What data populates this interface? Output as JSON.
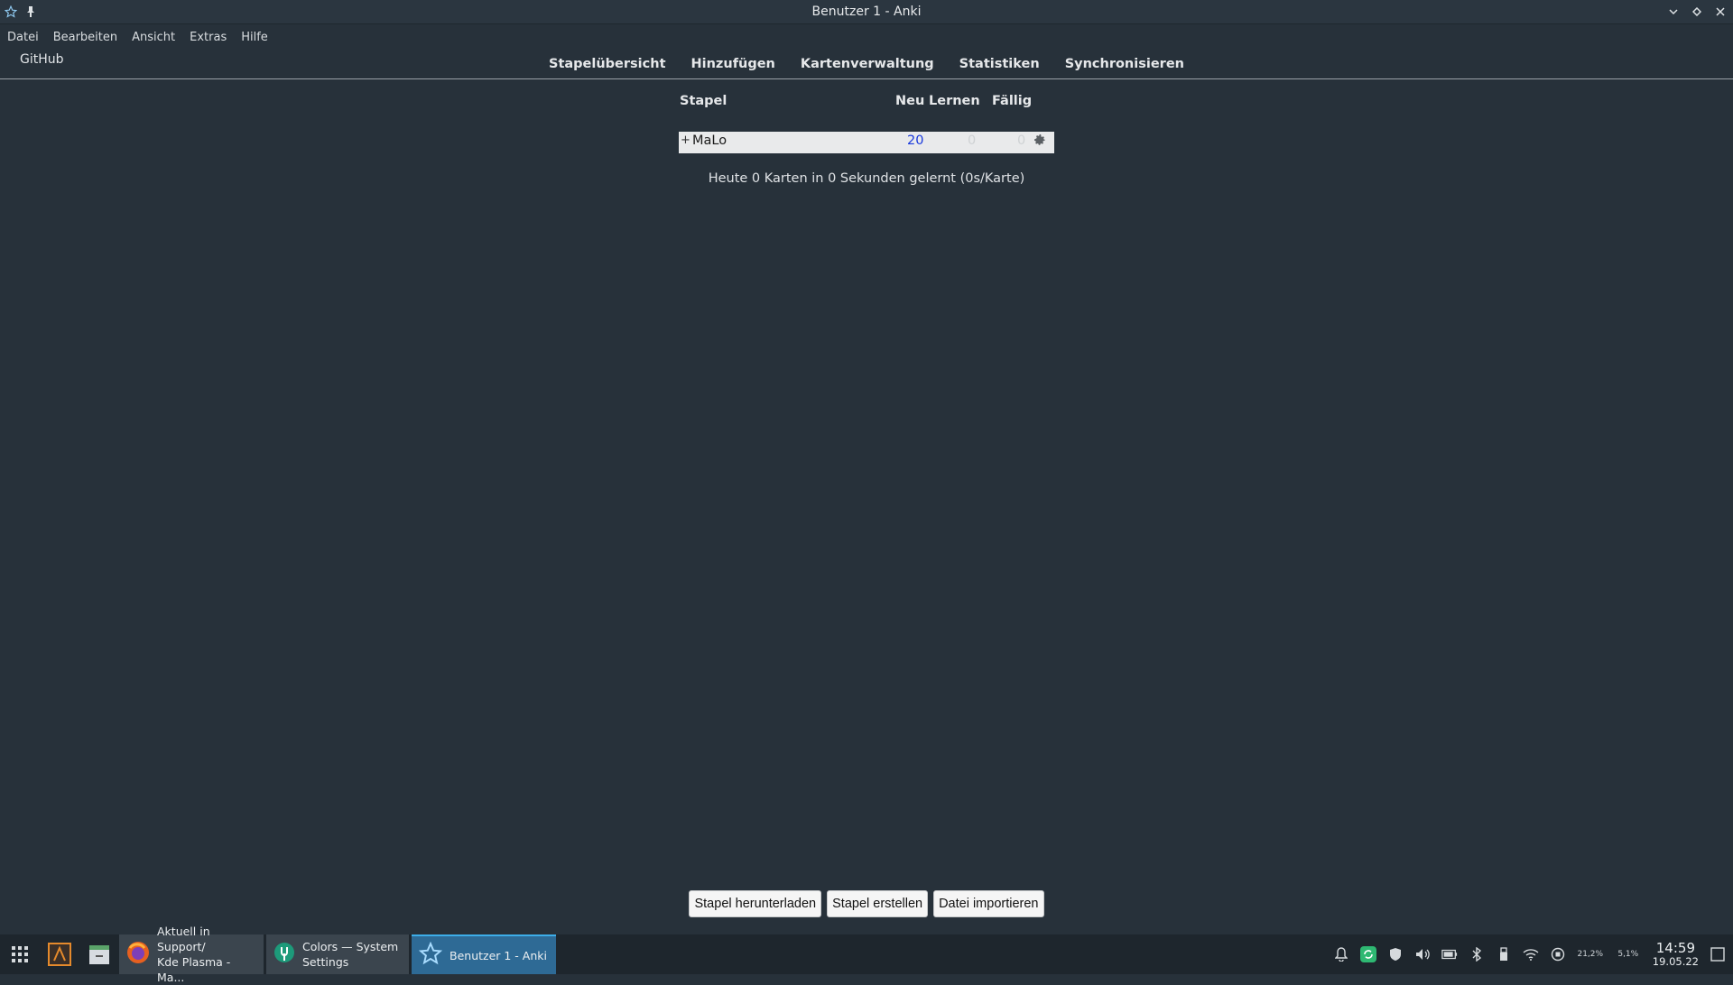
{
  "window": {
    "title": "Benutzer 1 - Anki"
  },
  "menu": [
    "Datei",
    "Bearbeiten",
    "Ansicht",
    "Extras",
    "Hilfe"
  ],
  "toolbar": {
    "github": "GitHub",
    "nav": [
      "Stapelübersicht",
      "Hinzufügen",
      "Kartenverwaltung",
      "Statistiken",
      "Synchronisieren"
    ]
  },
  "decks": {
    "headers": {
      "deck": "Stapel",
      "new": "Neu",
      "learn": "Lernen",
      "due": "Fällig"
    },
    "rows": [
      {
        "expand": "+",
        "name": "MaLo",
        "new": "20",
        "learn": "0",
        "due": "0"
      }
    ]
  },
  "today": "Heute 0 Karten in 0 Sekunden gelernt (0s/Karte)",
  "buttons": {
    "download": "Stapel herunterladen",
    "create": "Stapel erstellen",
    "import": "Datei importieren"
  },
  "taskbar": {
    "tasks": [
      {
        "line1": "Aktuell in Support/",
        "line2": "Kde Plasma - Ma..."
      },
      {
        "line1": "Colors — System",
        "line2": "Settings"
      },
      {
        "line1": "Benutzer 1 - Anki",
        "line2": ""
      }
    ],
    "cpu": "21,2%",
    "mem": "5,1%",
    "time": "14:59",
    "date": "19.05.22"
  },
  "colors": {
    "background": "#27313a",
    "accent": "#3daee9",
    "new_count": "#1a3adc"
  }
}
